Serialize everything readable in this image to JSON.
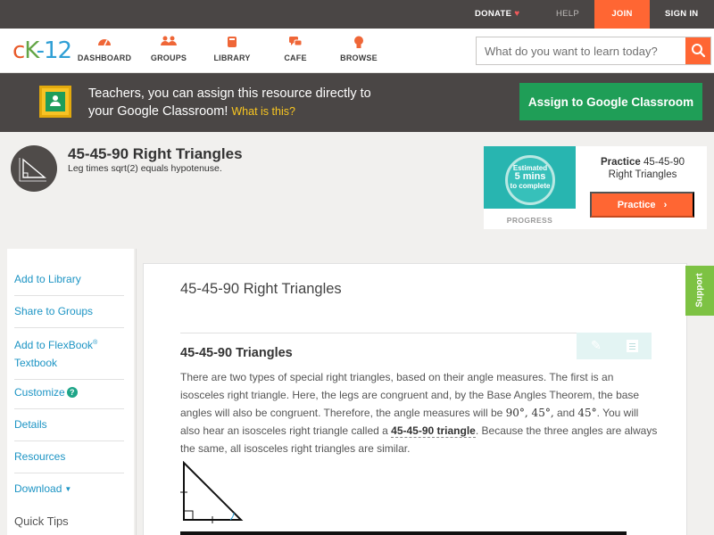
{
  "topbar": {
    "donate": "DONATE",
    "help": "HELP",
    "join": "JOIN",
    "signin": "SIGN IN"
  },
  "header": {
    "logo": {
      "c": "c",
      "k": "K",
      "n": "-12"
    },
    "nav": [
      {
        "label": "DASHBOARD",
        "icon": "dashboard-icon"
      },
      {
        "label": "GROUPS",
        "icon": "groups-icon"
      },
      {
        "label": "LIBRARY",
        "icon": "library-icon"
      },
      {
        "label": "CAFE",
        "icon": "cafe-icon"
      },
      {
        "label": "BROWSE",
        "icon": "lightbulb-icon"
      }
    ],
    "search_placeholder": "What do you want to learn today?"
  },
  "banner": {
    "message": "Teachers, you can assign this resource directly to your Google Classroom!",
    "what_link": "What is this?",
    "assign_button": "Assign to Google Classroom"
  },
  "lesson": {
    "title": "45-45-90 Right Triangles",
    "subtitle": "Leg times sqrt(2) equals hypotenuse."
  },
  "practice": {
    "estimated": "Estimated",
    "mins": "5 mins",
    "to_complete": "to complete",
    "progress_label": "PROGRESS",
    "title_bold": "Practice",
    "title_rest": "45-45-90 Right Triangles",
    "button": "Practice"
  },
  "sidebar": {
    "items": [
      "Add to Library",
      "Share to Groups",
      "Add to FlexBook",
      "Textbook",
      "Customize",
      "Details",
      "Resources",
      "Download"
    ],
    "flexbook_mark": "®",
    "help_mark": "?",
    "download_caret": "▼",
    "quick_tips": "Quick Tips"
  },
  "content": {
    "title": "45-45-90 Right Triangles",
    "section_heading": "45-45-90 Triangles",
    "para_1": "There are two types of special right triangles, based on their angle measures. The first is an isosceles right triangle. Here, the legs are congruent and, by the Base Angles Theorem, the base angles will also be congruent. Therefore, the angle measures will be ",
    "math_angles": "90°, 45°,",
    "and_word": " and ",
    "math_45": "45°",
    "para_2": ". You will also hear an isosceles right triangle called a ",
    "highlight": "45-45-90 triangle",
    "para_3": ". Because the three angles are always the same, all isosceles right triangles are similar."
  },
  "support": {
    "label": "Support"
  },
  "colors": {
    "brand_orange": "#ff6633",
    "dark_bar": "#4a4645",
    "classroom_green": "#1f9e57",
    "link_blue": "#1c94c4",
    "support_green": "#7dc243",
    "practice_teal": "#28b5b0"
  }
}
